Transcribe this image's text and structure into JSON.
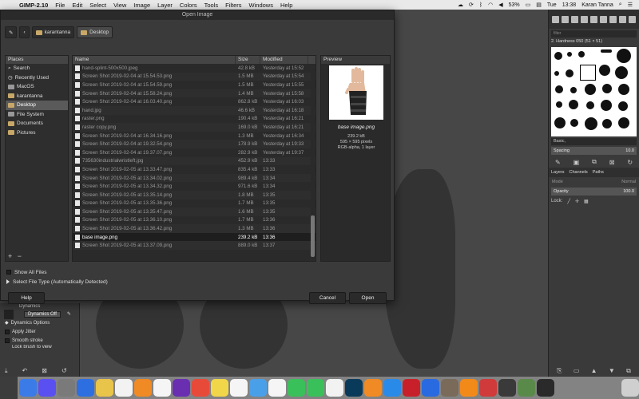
{
  "menubar": {
    "app_name": "GIMP-2.10",
    "items": [
      "File",
      "Edit",
      "Select",
      "View",
      "Image",
      "Layer",
      "Colors",
      "Tools",
      "Filters",
      "Windows",
      "Help"
    ],
    "battery": "53%",
    "day": "Tue",
    "time": "13:38",
    "user": "Karan Tanna"
  },
  "dialog": {
    "title": "Open Image",
    "path": [
      "karantanna",
      "Desktop"
    ],
    "places_header": "Places",
    "places": [
      "Search",
      "Recently Used",
      "MacOS",
      "karantanna",
      "Desktop",
      "File System",
      "Documents",
      "Pictures"
    ],
    "places_selected_index": 4,
    "columns": {
      "name": "Name",
      "size": "Size",
      "modified": "Modified"
    },
    "files": [
      {
        "name": "hand-splint-500x500.jpeg",
        "size": "42.8 kB",
        "modified": "Yesterday at 15:52"
      },
      {
        "name": "Screen Shot 2019-02-04 at 15.54.53.png",
        "size": "1.5 MB",
        "modified": "Yesterday at 15:54"
      },
      {
        "name": "Screen Shot 2019-02-04 at 15.54.59.png",
        "size": "1.5 MB",
        "modified": "Yesterday at 15:55"
      },
      {
        "name": "Screen Shot 2019-02-04 at 15.58.24.png",
        "size": "1.4 MB",
        "modified": "Yesterday at 15:58"
      },
      {
        "name": "Screen Shot 2019-02-04 at 16.03.40.png",
        "size": "862.8 kB",
        "modified": "Yesterday at 16:03"
      },
      {
        "name": "hand.jpg",
        "size": "46.6 kB",
        "modified": "Yesterday at 16:18"
      },
      {
        "name": "raster.png",
        "size": "190.4 kB",
        "modified": "Yesterday at 16:21"
      },
      {
        "name": "raster copy.png",
        "size": "169.0 kB",
        "modified": "Yesterday at 16:21"
      },
      {
        "name": "Screen Shot 2019-02-04 at 16.34.16.png",
        "size": "1.3 MB",
        "modified": "Yesterday at 16:34"
      },
      {
        "name": "Screen Shot 2019-02-04 at 19.32.54.png",
        "size": "178.9 kB",
        "modified": "Yesterday at 19:33"
      },
      {
        "name": "Screen Shot 2019-02-04 at 19.37.07.png",
        "size": "282.9 kB",
        "modified": "Yesterday at 19:37"
      },
      {
        "name": "735630industrialwristleft.jpg",
        "size": "452.9 kB",
        "modified": "13:33"
      },
      {
        "name": "Screen Shot 2019-02-05 at 13.33.47.png",
        "size": "835.4 kB",
        "modified": "13:33"
      },
      {
        "name": "Screen Shot 2019-02-05 at 13.34.02.png",
        "size": "989.4 kB",
        "modified": "13:34"
      },
      {
        "name": "Screen Shot 2019-02-05 at 13.34.32.png",
        "size": "971.6 kB",
        "modified": "13:34"
      },
      {
        "name": "Screen Shot 2019-02-05 at 13.35.14.png",
        "size": "1.8 MB",
        "modified": "13:35"
      },
      {
        "name": "Screen Shot 2019-02-05 at 13.35.36.png",
        "size": "1.7 MB",
        "modified": "13:35"
      },
      {
        "name": "Screen Shot 2019-02-05 at 13.35.47.png",
        "size": "1.6 MB",
        "modified": "13:35"
      },
      {
        "name": "Screen Shot 2019-02-05 at 13.36.10.png",
        "size": "1.7 MB",
        "modified": "13:36"
      },
      {
        "name": "Screen Shot 2019-02-05 at 13.36.42.png",
        "size": "1.3 MB",
        "modified": "13:36"
      },
      {
        "name": "base image.png",
        "size": "239.2 kB",
        "modified": "13:36"
      },
      {
        "name": "Screen Shot 2019-02-05 at 13.37.09.png",
        "size": "889.0 kB",
        "modified": "13:37"
      }
    ],
    "selected_file_index": 20,
    "preview": {
      "header": "Preview",
      "filename": "base image.png",
      "filesize": "239.2 kB",
      "dimensions": "595 × 595 pixels",
      "mode": "RGB-alpha, 1 layer"
    },
    "show_all_files": "Show All Files",
    "select_file_type": "Select File Type (Automatically Detected)",
    "help_label": "Help",
    "cancel_label": "Cancel",
    "open_label": "Open"
  },
  "left_dock": {
    "dynamics_label": "Dynamics",
    "dynamics_value": "Dynamics Off",
    "dynamics_options": "Dynamics Options",
    "apply_jitter": "Apply Jitter",
    "smooth_stroke": "Smooth stroke",
    "lock_brush": "Lock brush to view"
  },
  "right_dock": {
    "filter_placeholder": "filter",
    "brush_name": "2. Hardness 050 (51 × 51)",
    "brush_tag": "Basic,",
    "spacing_label": "Spacing",
    "spacing_value": "10.0",
    "tabs": [
      "Layers",
      "Channels",
      "Paths"
    ],
    "mode_label": "Mode",
    "mode_value": "Normal",
    "opacity_label": "Opacity",
    "opacity_value": "100.0",
    "lock_label": "Lock:"
  },
  "colors": {
    "accent_folder": "#c8a868",
    "dialog_bg": "#3a3a3a",
    "list_bg": "#2a2a2a",
    "selected_row": "#1e1e1e"
  },
  "dock_apps": [
    "finder-icon",
    "siri-icon",
    "launchpad-icon",
    "xcode-icon",
    "notes-icon",
    "calendar-icon",
    "books-icon",
    "reminders-icon",
    "imovie-icon",
    "chrome-icon",
    "stickies-icon",
    "textedit-icon",
    "preview-icon",
    "photos-icon",
    "messages-icon",
    "facetime-icon",
    "itunes-icon",
    "photoshop-icon",
    "ibooks-icon",
    "appstore-icon",
    "acrobat-icon",
    "sourcetree-icon",
    "archive-icon",
    "illustrator-icon",
    "scrobbler-icon",
    "dashboard-icon",
    "mobile-icon",
    "terminal-icon",
    "trash-icon"
  ]
}
